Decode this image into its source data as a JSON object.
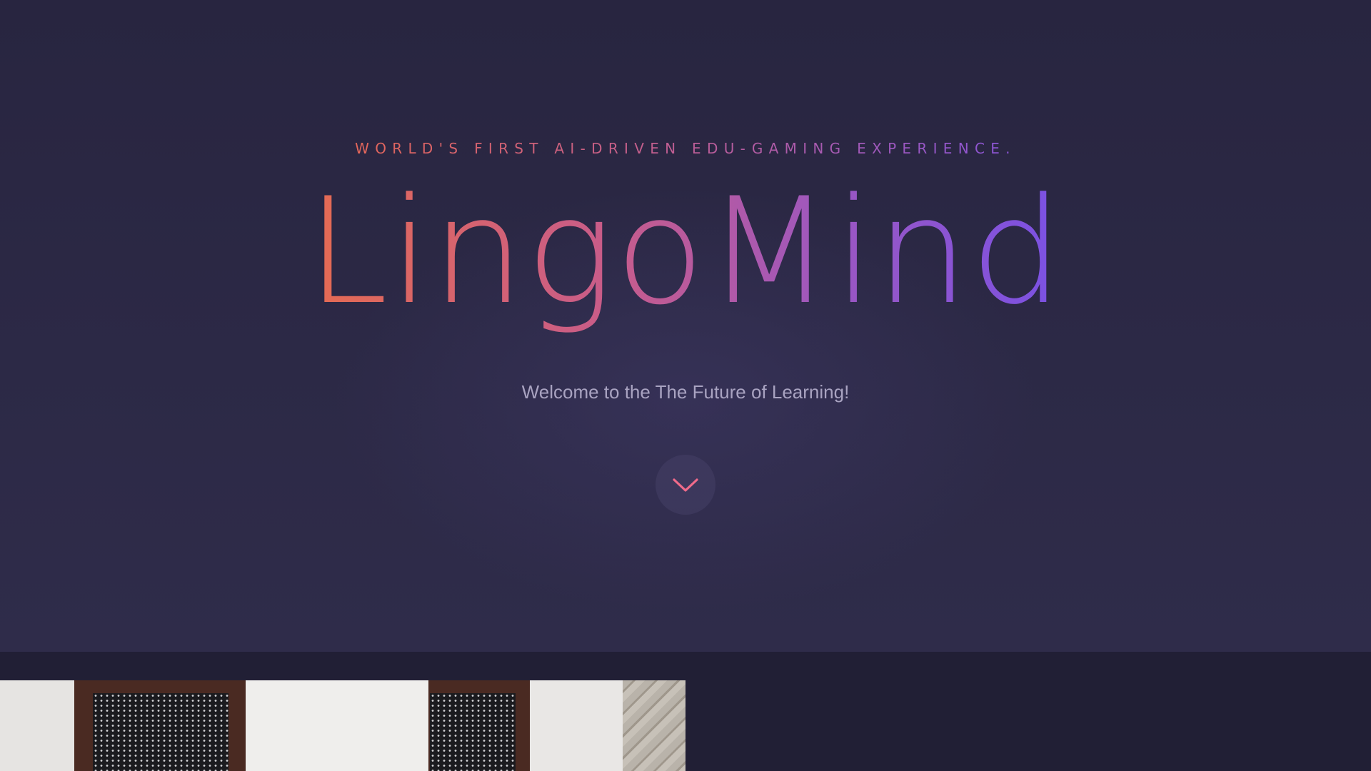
{
  "hero": {
    "tagline": "World's first AI-driven edu-gaming experience.",
    "brand_name": "LingoMind",
    "welcome_text": "Welcome to the The Future of Learning!",
    "scroll_button_icon": "chevron-down-icon"
  },
  "colors": {
    "background": "#2c2946",
    "gradient_start": "#e56b52",
    "gradient_mid": "#c85c8a",
    "gradient_end": "#7a51e4",
    "welcome_text": "#a9a3c1",
    "chevron": "#f06b8a"
  },
  "next_section": {
    "image": "interior photo with dark wooden shutters and stone wall"
  }
}
